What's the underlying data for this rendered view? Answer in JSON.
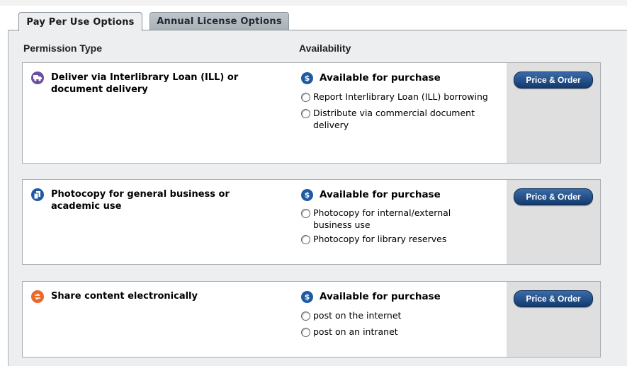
{
  "tabs": [
    {
      "label": "Pay Per Use Options",
      "active": true
    },
    {
      "label": "Annual License Options",
      "active": false
    }
  ],
  "columns": {
    "permission_type": "Permission Type",
    "availability": "Availability"
  },
  "permissions": [
    {
      "icon": "truck-icon",
      "icon_color": "#6b4f9e",
      "label": "Deliver via Interlibrary Loan (ILL) or document delivery",
      "availability": "Available for purchase",
      "options": [
        "Report Interlibrary Loan (ILL) borrowing",
        "Distribute via commercial document delivery"
      ],
      "button": "Price & Order"
    },
    {
      "icon": "copy-icon",
      "icon_color": "#1f5aa3",
      "label": "Photocopy for general business or academic use",
      "availability": "Available for purchase",
      "options": [
        "Photocopy for internal/external business use",
        "Photocopy for library reserves"
      ],
      "button": "Price & Order"
    },
    {
      "icon": "share-icon",
      "icon_color": "#e9692b",
      "label": "Share content electronically",
      "availability": "Available for purchase",
      "options": [
        "post on the internet",
        "post on an intranet"
      ],
      "button": "Price & Order"
    }
  ],
  "dollar_symbol": "$"
}
